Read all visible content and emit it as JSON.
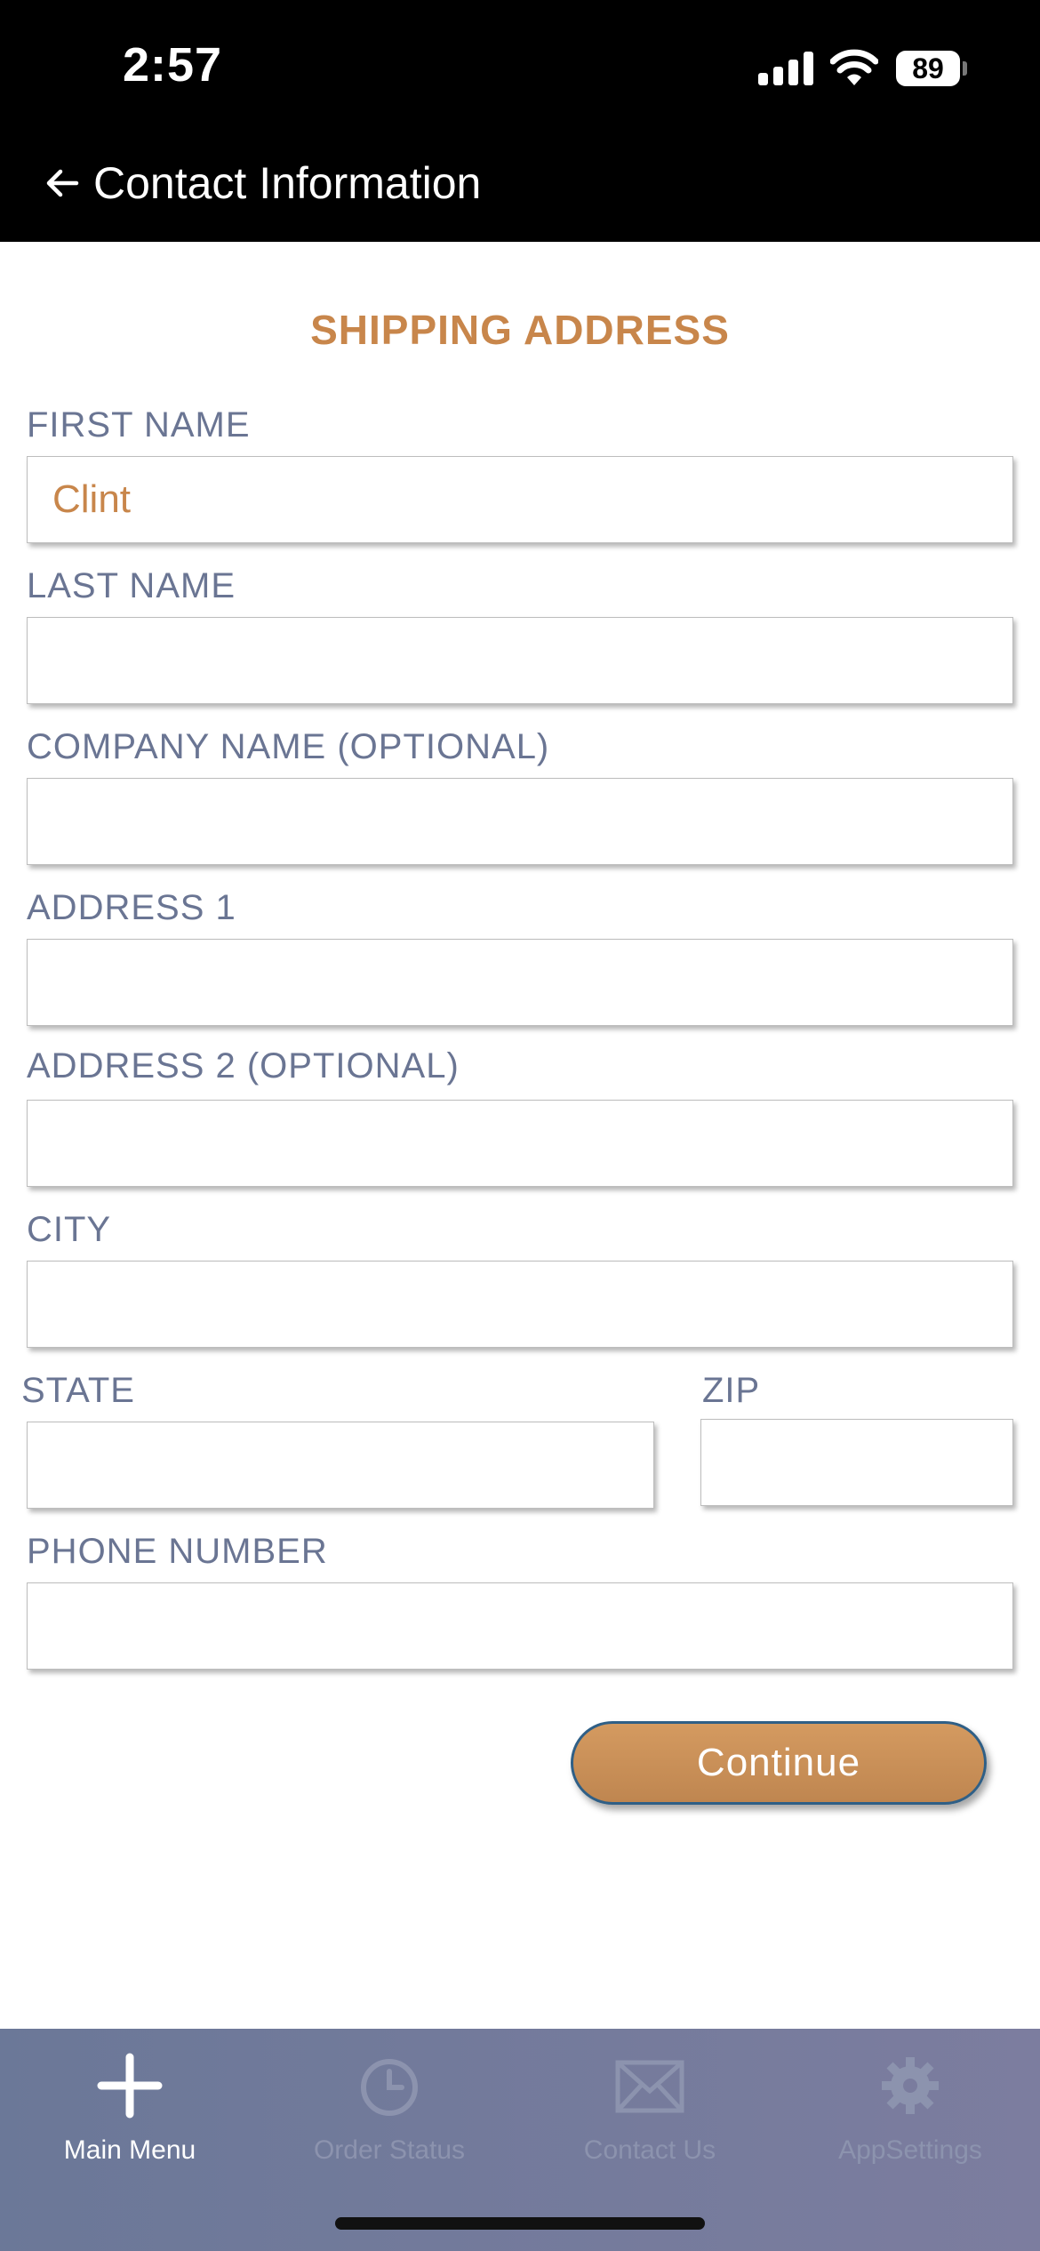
{
  "status_bar": {
    "time": "2:57",
    "battery": "89"
  },
  "header": {
    "title": "Contact Information"
  },
  "form": {
    "section_title": "SHIPPING ADDRESS",
    "fields": {
      "first_name": {
        "label": "FIRST NAME",
        "value": "Clint"
      },
      "last_name": {
        "label": "LAST NAME",
        "value": ""
      },
      "company": {
        "label": "COMPANY NAME (OPTIONAL)",
        "value": ""
      },
      "address1": {
        "label": "ADDRESS 1",
        "value": ""
      },
      "address2": {
        "label": "ADDRESS 2 (OPTIONAL)",
        "value": ""
      },
      "city": {
        "label": "CITY",
        "value": ""
      },
      "state": {
        "label": "STATE",
        "value": ""
      },
      "zip": {
        "label": "ZIP",
        "value": ""
      },
      "phone": {
        "label": "PHONE NUMBER",
        "value": ""
      }
    },
    "continue_label": "Continue"
  },
  "tabbar": {
    "items": [
      {
        "label": "Main Menu",
        "icon": "plus-icon",
        "active": true
      },
      {
        "label": "Order Status",
        "icon": "clock-icon",
        "active": false
      },
      {
        "label": "Contact Us",
        "icon": "envelope-icon",
        "active": false
      },
      {
        "label": "AppSettings",
        "icon": "gear-icon",
        "active": false
      }
    ]
  },
  "colors": {
    "accent": "#c8864b",
    "label": "#6a7593",
    "tabbar_start": "#6b7898",
    "tabbar_end": "#7c7d9f",
    "header_bg": "#000000"
  }
}
